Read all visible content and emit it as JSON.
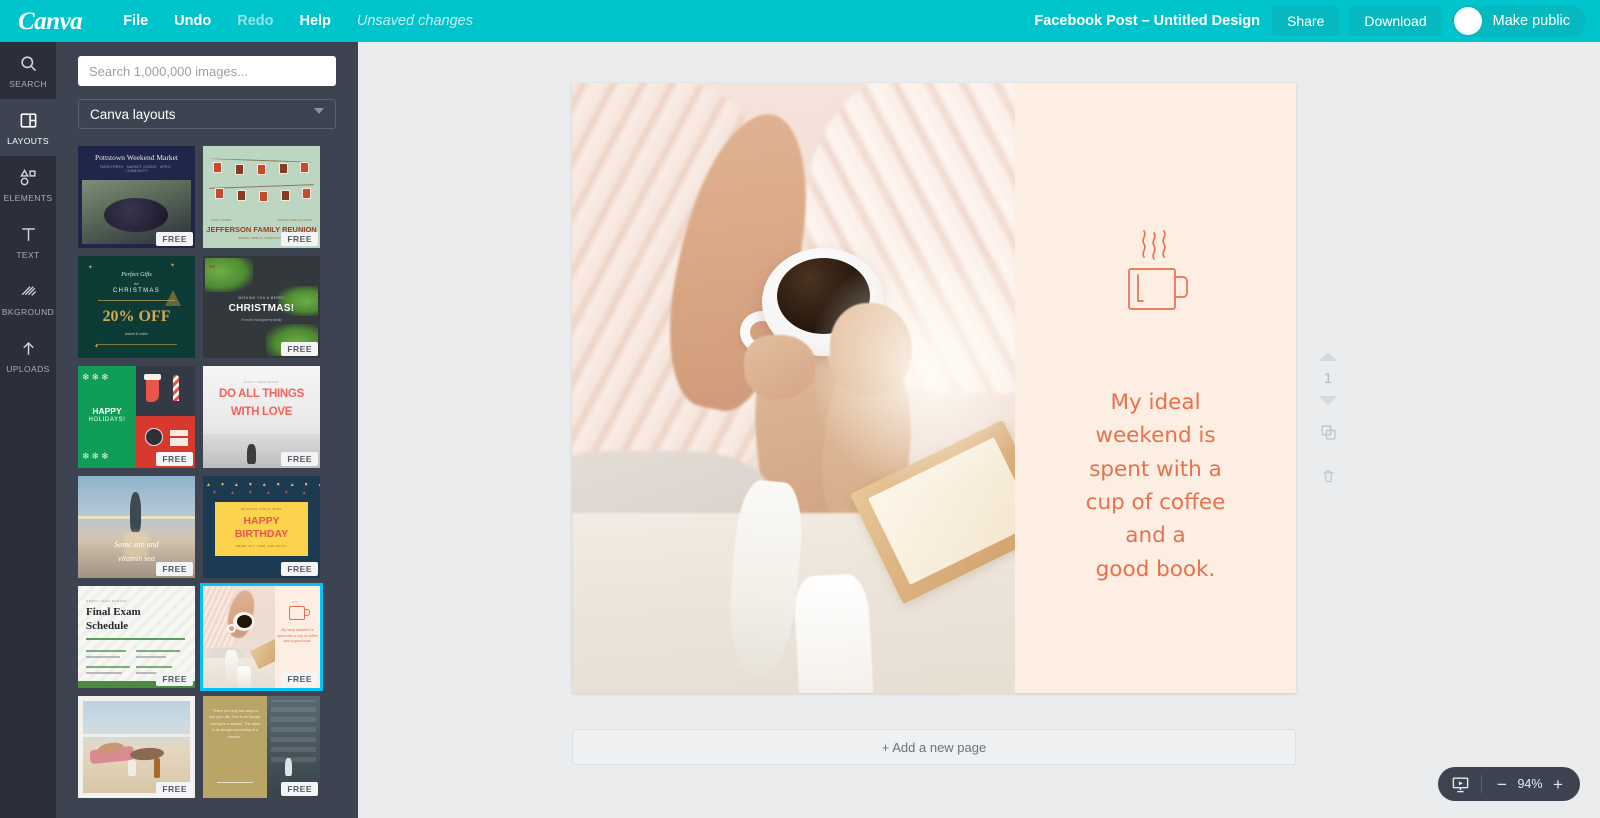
{
  "topbar": {
    "logo": "Canva",
    "menus": [
      {
        "label": "File",
        "dim": false
      },
      {
        "label": "Undo",
        "dim": false
      },
      {
        "label": "Redo",
        "dim": true
      },
      {
        "label": "Help",
        "dim": false
      }
    ],
    "status": "Unsaved changes",
    "doc_title": "Facebook Post – Untitled Design",
    "share_label": "Share",
    "download_label": "Download",
    "make_public_label": "Make public",
    "accent_color": "#00c4cc"
  },
  "rail": {
    "items": [
      {
        "label": "SEARCH",
        "icon": "search-icon",
        "active": false
      },
      {
        "label": "LAYOUTS",
        "icon": "layouts-icon",
        "active": true
      },
      {
        "label": "ELEMENTS",
        "icon": "elements-icon",
        "active": false
      },
      {
        "label": "TEXT",
        "icon": "text-icon",
        "active": false
      },
      {
        "label": "BKGROUND",
        "icon": "background-icon",
        "active": false
      },
      {
        "label": "UPLOADS",
        "icon": "upload-icon",
        "active": false
      }
    ]
  },
  "panel": {
    "search_placeholder": "Search 1,000,000 images...",
    "search_value": "",
    "category_value": "Canva layouts",
    "free_badge": "FREE",
    "thumbnails": [
      {
        "id": "pottstown-weekend-market",
        "title": "Pottstown Weekend Market",
        "subtitle": "FARM FRESH · MARKET GOODS · APRIL · COMMUNITY",
        "free": true,
        "selected": false
      },
      {
        "id": "jefferson-family-reunion",
        "title": "JEFFERSON FAMILY REUNION",
        "subtitle": "SUNDAY, JUNE 14 · NOON TO FIVE",
        "eyebrow_left": "APRIL CLOSER",
        "eyebrow_right": "PRAIRIE LANE, ELKHORN",
        "free": true,
        "selected": false
      },
      {
        "id": "christmas-20-off",
        "title": "20% OFF",
        "eyebrow": "Perfect Gifts",
        "sub_eyebrow": "for",
        "heading": "CHRISTMAS",
        "footer": "instore & online",
        "free": false,
        "selected": false
      },
      {
        "id": "merry-christmas",
        "title": "CHRISTMAS!",
        "eyebrow": "WISHING YOU A MERRY",
        "footer": "From the Montgomery family",
        "free": true,
        "selected": false
      },
      {
        "id": "happy-holidays",
        "title": "HAPPY",
        "subtitle": "HOLIDAYS!",
        "free": true,
        "selected": false
      },
      {
        "id": "do-all-things-with-love",
        "title": "DO ALL THINGS",
        "subtitle": "WITH LOVE",
        "eyebrow": "DAILY REMINDER",
        "free": true,
        "selected": false
      },
      {
        "id": "some-sun-and-vitamin-sea",
        "title": "Some sun and",
        "subtitle": "vitamin sea",
        "free": true,
        "selected": false
      },
      {
        "id": "happy-birthday",
        "title": "HAPPY",
        "subtitle": "BIRTHDAY",
        "eyebrow": "WISHING YOU A VERY",
        "footer": "FROM: ALY, JAZZ, AND PATTY",
        "free": true,
        "selected": false
      },
      {
        "id": "final-exam-schedule",
        "title": "Final Exam",
        "subtitle": "Schedule",
        "eyebrow": "GRAFF HIGH SCHOOL",
        "free": true,
        "selected": false
      },
      {
        "id": "ideal-weekend-coffee",
        "title": "My ideal weekend is spent with a cup of coffee and a good book.",
        "free": true,
        "selected": true
      },
      {
        "id": "beach-sunbathing",
        "title": "",
        "free": true,
        "selected": false
      },
      {
        "id": "two-ways-to-live-quote",
        "title": "\"There are only two ways to live your life. One is as though nothing is a miracle. The other is as though everything is a miracle.\"",
        "free": true,
        "selected": false
      }
    ]
  },
  "canvas": {
    "design_title": "ideal-weekend-coffee",
    "text_panel": {
      "background_color": "#fceee3",
      "text_color": "#e8714b",
      "icon": "coffee-mug-icon",
      "lines": [
        "My ideal",
        "weekend is",
        "spent with a",
        "cup of coffee",
        "and a",
        "good book."
      ]
    },
    "photo_alt": "Person in fuzzy sweater holding a cup of black coffee with white socks and an open book on a bed"
  },
  "page_controls": {
    "page_number": "1",
    "move_up_icon": "chevron-up-icon",
    "move_down_icon": "chevron-down-icon",
    "duplicate_icon": "duplicate-icon",
    "delete_icon": "trash-icon"
  },
  "add_page": {
    "label": "+ Add a new page"
  },
  "zoom_bar": {
    "present_icon": "present-icon",
    "minus_label": "−",
    "value": "94%",
    "plus_label": "+"
  }
}
